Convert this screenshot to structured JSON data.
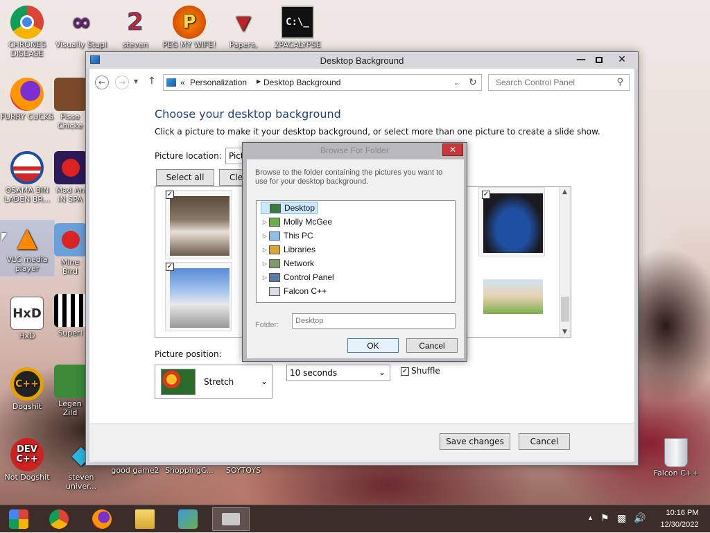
{
  "desktop_icons": [
    {
      "label": "CHRONES DISEASE",
      "icon": "chrome-icon"
    },
    {
      "label": "Visually Stupi",
      "icon": "visual-studio-icon"
    },
    {
      "label": "steven",
      "icon": "steven-icon"
    },
    {
      "label": "PEG MY WIFE!",
      "icon": "peg-icon"
    },
    {
      "label": "Papers,",
      "icon": "papers-icon"
    },
    {
      "label": "2PACALYPSE",
      "icon": "console-icon"
    },
    {
      "label": "FURRY CUCKS",
      "icon": "firefox-icon"
    },
    {
      "label": "Pisse Chicke",
      "icon": "chicken-game-icon"
    },
    {
      "label": "OSAMA BIN LADEN BR...",
      "icon": "obama-logo-icon"
    },
    {
      "label": "Mad An IN SPA",
      "icon": "angry-birds-space-icon"
    },
    {
      "label": "VLC media player",
      "icon": "vlc-icon"
    },
    {
      "label": "Mine Bird",
      "icon": "angry-birds-icon"
    },
    {
      "label": "HxD",
      "icon": "hxd-icon"
    },
    {
      "label": "Superl",
      "icon": "qr-icon"
    },
    {
      "label": "Dogshit",
      "icon": "codeblocks-icon"
    },
    {
      "label": "Legen Zild",
      "icon": "legend-icon"
    },
    {
      "label": "Not Dogshit",
      "icon": "devcpp-icon"
    },
    {
      "label": "steven univer...",
      "icon": "diamond-icon"
    },
    {
      "label": "good game2",
      "icon": "file-icon"
    },
    {
      "label": "ShoppingC...",
      "icon": "file-icon"
    },
    {
      "label": "SOYTOYS",
      "icon": "file-icon"
    },
    {
      "label": "Falcon C++",
      "icon": "recycle-bin-icon"
    }
  ],
  "window": {
    "title": "Desktop Background",
    "address": {
      "prefix": "«",
      "crumb1": "Personalization",
      "crumb2": "Desktop Background"
    },
    "search_placeholder": "Search Control Panel",
    "heading": "Choose your desktop background",
    "subline": "Click a picture to make it your desktop background, or select more than one picture to create a slide show.",
    "picture_location_label": "Picture location:",
    "picture_location_value": "Pict",
    "select_all": "Select all",
    "clear_all": "Clea",
    "picture_position_label": "Picture position:",
    "picture_position_value": "Stretch",
    "interval_value": "10 seconds",
    "shuffle_label": "Shuffle",
    "save": "Save changes",
    "cancel": "Cancel"
  },
  "dialog": {
    "title": "Browse For Folder",
    "description": "Browse to the folder containing the pictures you want to use for your desktop background.",
    "tree": [
      {
        "label": "Desktop",
        "selected": true,
        "expandable": false,
        "icon": "desktop-icon"
      },
      {
        "label": "Molly McGee",
        "selected": false,
        "expandable": true,
        "icon": "user-folder-icon"
      },
      {
        "label": "This PC",
        "selected": false,
        "expandable": true,
        "icon": "computer-icon"
      },
      {
        "label": "Libraries",
        "selected": false,
        "expandable": true,
        "icon": "libraries-icon"
      },
      {
        "label": "Network",
        "selected": false,
        "expandable": true,
        "icon": "network-icon"
      },
      {
        "label": "Control Panel",
        "selected": false,
        "expandable": true,
        "icon": "control-panel-icon"
      },
      {
        "label": "Falcon C++",
        "selected": false,
        "expandable": false,
        "icon": "recycle-bin-icon"
      }
    ],
    "folder_label": "Folder:",
    "folder_value": "Desktop",
    "ok": "OK",
    "cancel": "Cancel"
  },
  "taskbar": {
    "time": "10:16 PM",
    "date": "12/30/2022"
  },
  "colors": {
    "heading_blue": "#1e3f87",
    "close_red": "#c7383a",
    "taskbar": "#3c2c2a"
  }
}
